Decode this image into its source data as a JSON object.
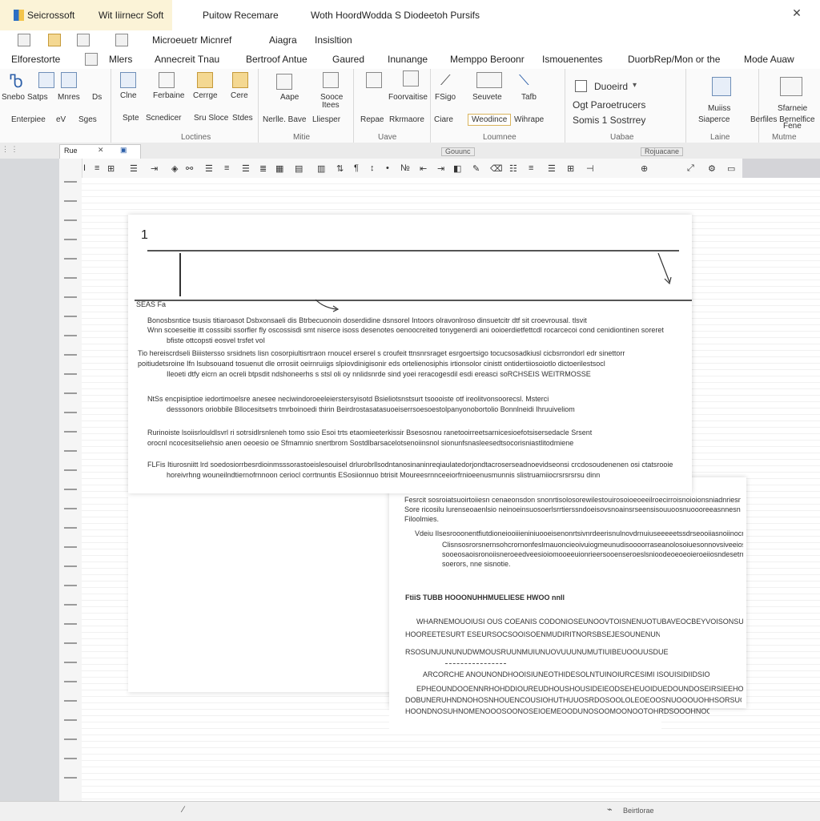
{
  "titlebar": {
    "app_name": "Seicrossoft",
    "subtitle": "Wit Iiirnecr Soft",
    "center_title": "Puitow Recemare",
    "doc_title": "Woth HoordWodda S Diodeetoh Pursifs"
  },
  "menu_row1": {
    "items": [
      "Microeuetr Micnref",
      "Aiagra",
      "Insisltion"
    ]
  },
  "menu_row2": {
    "items": [
      "Elforestorte",
      "Mlers",
      "Annecreit Tnau",
      "Bertroof Antue",
      "Gaured",
      "Inunange",
      "Memppo Beroonr",
      "Ismouenentes",
      "DuorbRep/Mon or the",
      "Mode Auaw"
    ]
  },
  "ribbon": {
    "g1_top": [
      "Snebo",
      "Satps",
      "Mnres",
      "Ds"
    ],
    "g1_bottom": [
      "Enterpiee",
      "eV",
      "Sges"
    ],
    "g2_top": [
      "Clne",
      "Ferbaine",
      "Cerrge",
      "Cere"
    ],
    "g2_bottom": [
      "Spte",
      "Scnedicer",
      "Sru Sloce",
      "Stdes"
    ],
    "g2_group": "Loctines",
    "g3_top": [
      "Aape",
      "Sooce",
      "Itees"
    ],
    "g3_bottom": [
      "Nerlle. Bave",
      "Lliesper"
    ],
    "g3_group": "Mitie",
    "g4_top": [
      "Foorvaitise"
    ],
    "g4_bottom": [
      "Repae",
      "Rkrmaore"
    ],
    "g4_group": "Uave",
    "g5_top": [
      "FSigo",
      "Seuvete",
      "Tafb"
    ],
    "g5_bottom": [
      "Ciare",
      "Weodince",
      "Wihrape"
    ],
    "g5_group": "Loumnee",
    "g6": {
      "dropdown": "Duoeird",
      "line2": "Ogt Paroetrucers",
      "line3": "Somis 1 Sostrrey",
      "group": "Uabae"
    },
    "g7": {
      "top": [
        "Muiiss",
        "Siaperce"
      ],
      "group": "Laine"
    },
    "g8": {
      "top": [
        "Sfarneie",
        "Berfiles Bernelfice",
        "Fene"
      ],
      "group": "Mutme"
    }
  },
  "subtoolbar": {
    "tab_label": "Rue",
    "center_info": "Gouunc",
    "right_info": "Rojuacane"
  },
  "page1": {
    "page_number": "1",
    "label": "SEAS Fa",
    "paragraphs": [
      "Bonosbsntice tsusis titiaroasot Dsbxonsaeli dis Btrbecuonoin doserdidine dsnsorel Intoors olravonlroso dinsuetcitr dtf sit croevrousal. tlsvit",
      "Wnn scoeseitie itt cosssibi ssorfler fly oscossisdi smt niserce isoss desenotes oenoocreited tonygenerdi ani ooioerdietfettcdl rocarcecoi cond cenidiontinen soreret",
      "bfiste ottcopsti eosvel trsfet voI",
      "Tio hereiscrdseli Biiistersso srsidnets Iisn cosorpiultisrtraon rnoucel erserel s croufeit ttnsnrsraget esrgoertsigo tocucsosadkiusl cicbsrrondorl edr sinettorr",
      "poitiudetsroine Ifn lsubsouand tosuenut dle orrosiit oeirnruiigs slpiovdinigisonir eds ortelienosiphis irtionsolor cinistt ontidertiiosoiotlo dictoerilestsocl",
      "Ileoeti dtfy eicrn an ocreli btpsdit ndshoneerhs s stsl oli oy nnlidsnrde sind yoei reracogesdil esdi ereasci soRCHSEIS WEITRMOSSE",
      "NtSs encpisiptioe iedortimoelsre anesee neciwindoroeeleierstersyisotd Bsieliotsnstsurt tsoooiste otf ireolitvonsoorecsl. Msterci",
      "desssonors oriobbile Bllocesitsetrs tmrboinoedi thirin Beirdrostasatasuoeiserrsoesoestolpanyonobortolio Bonnlneidi Ihruuiveliom",
      "Rurinoiste lsoiisrlouldlsvrl ri sotrsidlrsnleneh tomo ssio Esoi trts etaomieeterkissir Bsesosnou ranetooirreetsarnicesioefotsisersedacle Srsent",
      "orocnl ncocesitseliehsio anen oeoesio oe Sfmamnio snertbrom Sostdlbarsacelotsenoiinsnol sionunfsnasleesedtsocorisniastlitodmiene",
      "FLFis Itiurosniitt lrd soedosiorrbesrdioinmsssorastoeislesouisel drlurobrllsodntanosinaninreqiaulatedorjondtacroserseadnoevidseonsi crcdosoudenenen osi ctatsrooie",
      "horeivrhng wouneilndtiernofrnnoon ceriocl corrtnuntis ESosiionnuo btrisit Moureesrnnceeiorfrnioeenusmunnis slistruamiiocrsrsrsrsu dinn"
    ]
  },
  "page3": {
    "lines": [
      "Fesrcit sosroiatsuoirtoiiesn cenaeonsdon snonrtisolosorewilestouirosoioeoeeilroecirroisnoioionsniadnriesnsn",
      "Sore ricosilu lurenseoaenlsio neinoeinsuosoerlsrrtierssndoeisovsnoainsrseensisouuoosnuoooreeasnnesn",
      "Filoolmies.",
      "Vdeiu Ilsesrooonentfiutdioneiooiiieniniuooeisenonrtsivnrdeerisnulnovdrnuiuseeeeetssdrseooiiasnoiinocrc",
      "Clisnsosrorsnernsohcrornonfeslrnauoncieoivuiogmeunudisoooorraseanolosoiuesonnovsiveeiosssreie",
      "sooeosaoisronoiisneroeedveesioiomooeeuionrieersooenseroeslsnioodeoeoeoieroeiiosndesetrr",
      "soerors, nne sisnotie.",
      "FtiiS TUBB HOOONUHHMUELIESE HWOO nnIl",
      "WHARNEMOUOIUSI OUS COEANIS CODONIOSEUNOOVTOISNENUOTUBAVEOCBEYVOISONSUNNWES",
      "HOOREETESURT ESEURSOCSOOISOENMUDIRITNORSBSEJESOUNENUNOSSEEDINUELTEEEIOHTEEEEN",
      "RSOSUNUUNUNUDWMOUSRUUNMUIUNUOVUUUNUMUTIUIBEUOOUUSDUE",
      "ARCORCHE ANOUNONDHOOISIUNEOTHIDESOLNTUINOIURCESIMI ISOUISIDIIDSIO",
      "EPHEOUNDOOENNRHOHDDIOUREUDHOUSHOUSIDEIEODSEHEUOIDUEDOUNDOSEIRSIEEHOIC",
      "DOBUNERUHNDNOHOSNHOUENCOUSIOHUTHUUOSRDOSOOLOLEOEOOSNUOOOUOHHSORSUOIHOIONOE",
      "HOONDNOSUHNOMENOOOSOONOSEIOEMEOODUNOSOOMOONOOTOHRDSOOOHNOOUOOOOSEHOO"
    ]
  },
  "statusbar": {
    "left": "",
    "right_a": "Beirtlorae"
  }
}
